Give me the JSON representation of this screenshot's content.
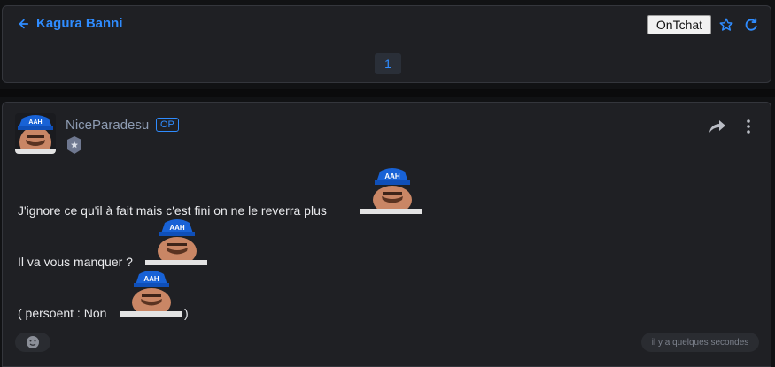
{
  "header": {
    "back_label": "Kagura Banni",
    "chat_button_label": "OnTchat",
    "page_number": "1"
  },
  "post": {
    "username": "NiceParadesu",
    "op_label": "OP",
    "lines": [
      "J'ignore ce qu'il à fait mais c'est fini on ne le reverra plus",
      "Il va vous manquer ?",
      "( persoent : Non",
      ")"
    ],
    "sticker_text": "AAH",
    "timestamp": "il y a quelques secondes"
  },
  "icons": {
    "back": "arrow-left-icon",
    "star": "star-icon",
    "refresh": "refresh-icon",
    "share": "share-icon",
    "more": "more-vertical-icon",
    "rank": "shield-rank-icon",
    "reaction": "emoji-icon"
  },
  "colors": {
    "accent": "#2f8cff",
    "card_bg": "#1f2024",
    "page_bg": "#111214"
  }
}
